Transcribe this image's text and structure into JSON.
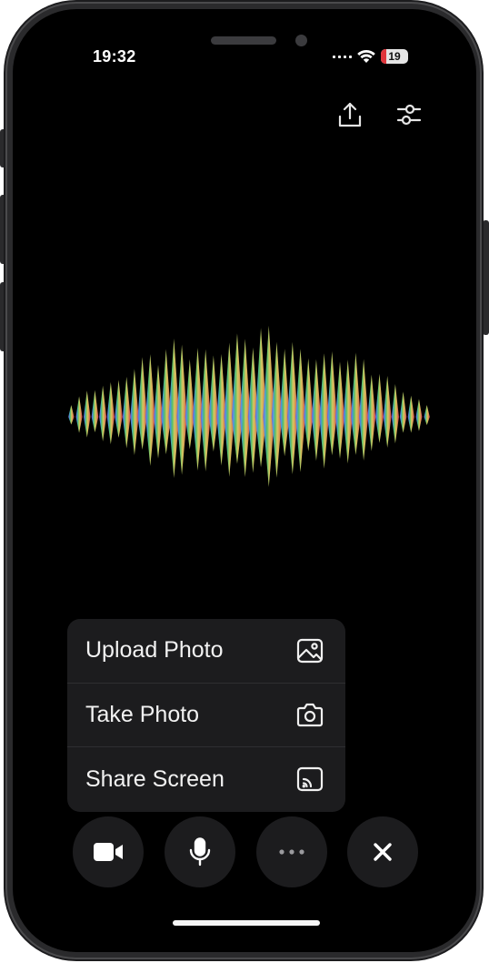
{
  "status_bar": {
    "time": "19:32",
    "battery_level": "19",
    "battery_fraction": 0.19,
    "battery_color": "#e0353b"
  },
  "toolbar": {
    "share_icon": "share-upload-icon",
    "settings_icon": "sliders-settings-icon"
  },
  "visualizer": {
    "type": "rainbow-audio-waveform",
    "gradient": [
      "#7b4fd8",
      "#4aa7e6",
      "#5fd16f",
      "#e8d96a",
      "#e86a5a",
      "#e84b6a"
    ]
  },
  "menu": {
    "items": [
      {
        "label": "Upload Photo",
        "icon": "photo-icon"
      },
      {
        "label": "Take Photo",
        "icon": "camera-icon"
      },
      {
        "label": "Share Screen",
        "icon": "screen-cast-icon"
      }
    ]
  },
  "controls": {
    "video": "video-camera-icon",
    "mic": "microphone-icon",
    "more": "more-dots-icon",
    "close": "close-icon"
  }
}
